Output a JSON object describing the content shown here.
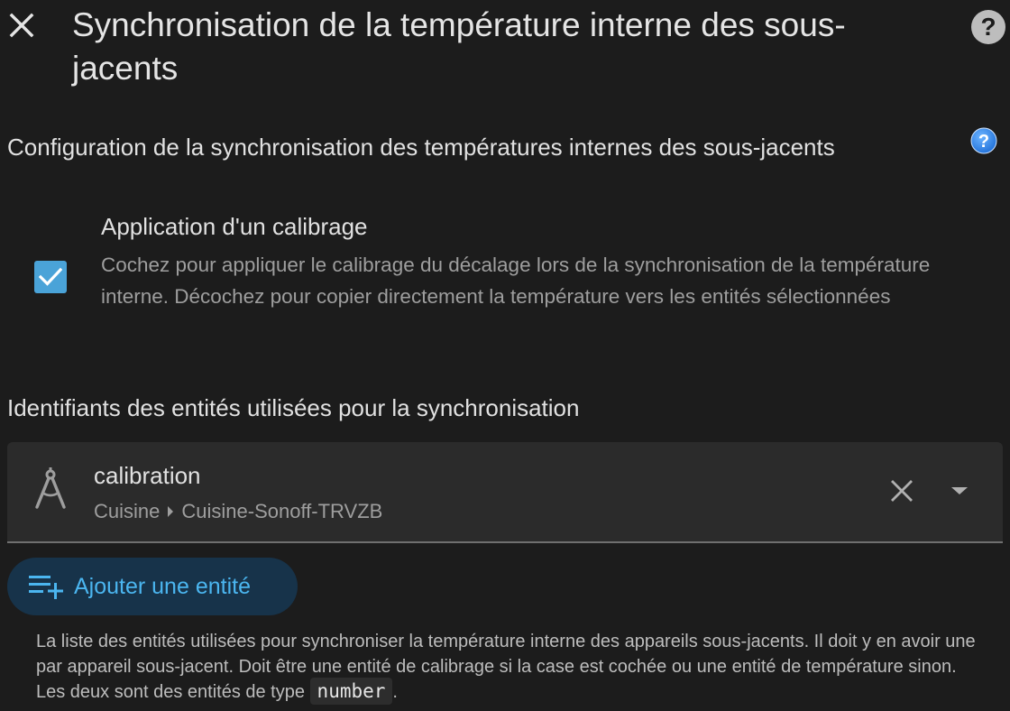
{
  "dialog": {
    "title": "Synchronisation de la température interne des sous-jacents",
    "close_icon": "close-icon",
    "help_icon": "help-circle-icon"
  },
  "section": {
    "title": "Configuration de la synchronisation des températures internes des sous-jacents",
    "info_icon": "info-icon"
  },
  "calibration_option": {
    "checked": true,
    "label": "Application d'un calibrage",
    "description": "Cochez pour appliquer le calibrage du décalage lors de la synchronisation de la température interne. Décochez pour copier directement la température vers les entités sélectionnées"
  },
  "entities": {
    "label": "Identifiants des entités utilisées pour la synchronisation",
    "items": [
      {
        "name": "calibration",
        "area": "Cuisine",
        "device": "Cuisine-Sonoff-TRVZB",
        "icon": "compass-drafting-icon"
      }
    ],
    "add_button_label": "Ajouter une entité",
    "add_button_icon": "playlist-plus-icon"
  },
  "helper": {
    "text_before": "La liste des entités utilisées pour synchroniser la température interne des appareils sous-jacents. Il doit y en avoir une par appareil sous-jacent. Doit être une entité de calibrage si la case est cochée ou une entité de température sinon. Les deux sont des entités de type ",
    "code": "number",
    "text_after": "."
  },
  "colors": {
    "background": "#1c1c1c",
    "accent": "#4aa3d8",
    "button_text": "#4bb6f0",
    "button_bg": "#17334a",
    "card_bg": "#2b2b2b"
  }
}
